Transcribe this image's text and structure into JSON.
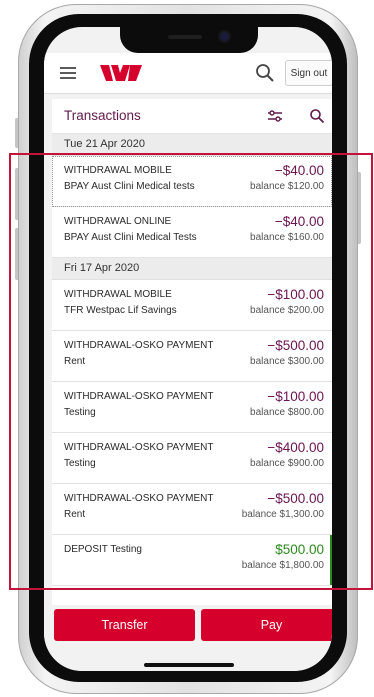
{
  "header": {
    "sign_out_label": "Sign out",
    "brand_color": "#d5002b"
  },
  "transactions_panel": {
    "title": "Transactions",
    "groups": [
      {
        "date": "Tue 21 Apr 2020",
        "items": [
          {
            "type": "WITHDRAWAL MOBILE",
            "description": "BPAY Aust Clini Medical tests",
            "amount": "−$40.00",
            "balance": "balance $120.00"
          },
          {
            "type": "WITHDRAWAL ONLINE",
            "description": "BPAY Aust Clini Medical Tests",
            "amount": "−$40.00",
            "balance": "balance $160.00"
          }
        ]
      },
      {
        "date": "Fri 17 Apr 2020",
        "items": [
          {
            "type": "WITHDRAWAL MOBILE",
            "description": "TFR Westpac Lif Savings",
            "amount": "−$100.00",
            "balance": "balance $200.00"
          },
          {
            "type": "WITHDRAWAL-OSKO PAYMENT",
            "description": "Rent",
            "amount": "−$500.00",
            "balance": "balance $300.00"
          },
          {
            "type": "WITHDRAWAL-OSKO PAYMENT",
            "description": "Testing",
            "amount": "−$100.00",
            "balance": "balance $800.00"
          },
          {
            "type": "WITHDRAWAL-OSKO PAYMENT",
            "description": "Testing",
            "amount": "−$400.00",
            "balance": "balance $900.00"
          },
          {
            "type": "WITHDRAWAL-OSKO PAYMENT",
            "description": "Rent",
            "amount": "−$500.00",
            "balance": "balance $1,300.00"
          },
          {
            "type": "DEPOSIT Testing",
            "description": "",
            "amount": "$500.00",
            "balance": "balance $1,800.00"
          }
        ]
      }
    ],
    "debit_color": "#6b1450",
    "credit_color": "#2b8a1e"
  },
  "actions": {
    "transfer_label": "Transfer",
    "pay_label": "Pay"
  }
}
